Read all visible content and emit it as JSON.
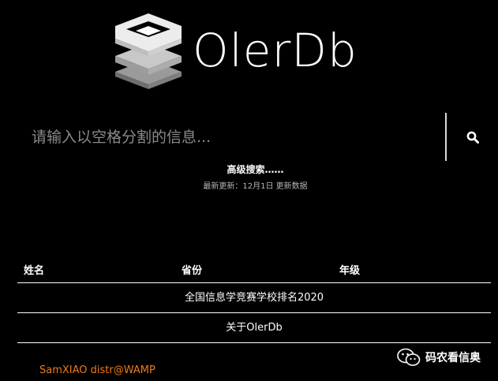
{
  "logo": {
    "title": "OlerDb"
  },
  "search": {
    "placeholder": "请输入以空格分割的信息...",
    "value": ""
  },
  "advanced_search_label": "高级搜索……",
  "update": {
    "text": "最新更新：12月1日 更新数据"
  },
  "table": {
    "headers": [
      "姓名",
      "省份",
      "年级"
    ],
    "rows": [
      "全国信息学竞赛学校排名2020",
      "关于OlerDb"
    ]
  },
  "footer": {
    "credit": "SamXIAO distr@WAMP"
  },
  "watermark": {
    "text": "码农看信奥"
  },
  "colors": {
    "background": "#000000",
    "text": "#ffffff",
    "credit": "#f07a18",
    "placeholder": "#8a8a8a"
  }
}
